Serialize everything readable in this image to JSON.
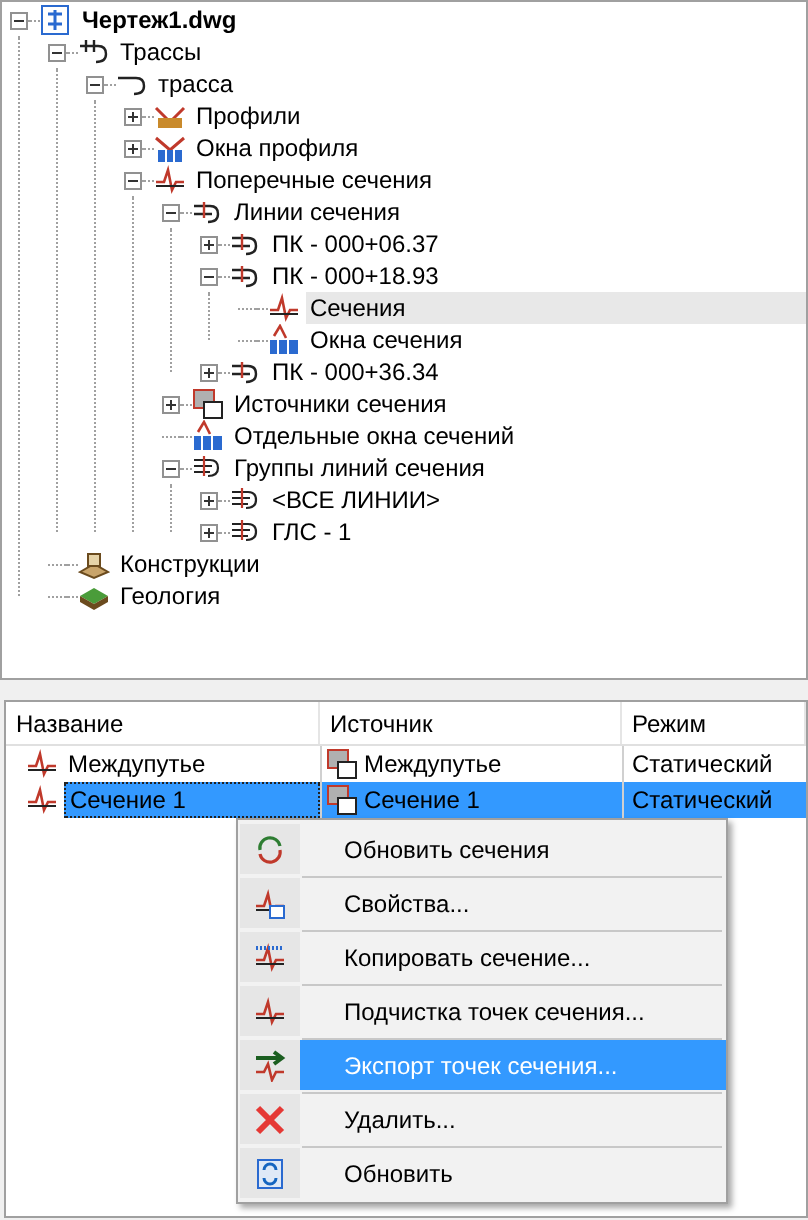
{
  "tree": [
    {
      "label": "Чертеж1.dwg",
      "kind": "drawing",
      "expanded": true,
      "selected": false,
      "children": [
        {
          "label": "Трассы",
          "kind": "alignments",
          "expanded": true,
          "selected": false,
          "children": [
            {
              "label": "трасса",
              "kind": "alignment",
              "expanded": true,
              "selected": false,
              "children": [
                {
                  "label": "Профили",
                  "kind": "profile",
                  "expanded": false,
                  "selected": false
                },
                {
                  "label": "Окна профиля",
                  "kind": "profile-view",
                  "expanded": false,
                  "selected": false
                },
                {
                  "label": "Поперечные сечения",
                  "kind": "section",
                  "expanded": true,
                  "selected": false,
                  "children": [
                    {
                      "label": "Линии сечения",
                      "kind": "sample-line",
                      "expanded": true,
                      "selected": false,
                      "children": [
                        {
                          "label": "ПК - 000+06.37",
                          "kind": "sample-line",
                          "expanded": false,
                          "selected": false
                        },
                        {
                          "label": "ПК - 000+18.93",
                          "kind": "sample-line",
                          "expanded": true,
                          "selected": false,
                          "children": [
                            {
                              "label": "Сечения",
                              "kind": "section",
                              "selected": true
                            },
                            {
                              "label": "Окна сечения",
                              "kind": "section-view",
                              "selected": false
                            }
                          ]
                        },
                        {
                          "label": "ПК - 000+36.34",
                          "kind": "sample-line",
                          "expanded": false,
                          "selected": false
                        }
                      ]
                    },
                    {
                      "label": "Источники сечения",
                      "kind": "sources",
                      "expanded": false,
                      "selected": false
                    },
                    {
                      "label": "Отдельные окна сечений",
                      "kind": "section-view",
                      "selected": false
                    },
                    {
                      "label": "Группы линий сечения",
                      "kind": "group",
                      "expanded": true,
                      "selected": false,
                      "children": [
                        {
                          "label": "<ВСЕ ЛИНИИ>",
                          "kind": "group",
                          "expanded": false,
                          "selected": false
                        },
                        {
                          "label": "ГЛС - 1",
                          "kind": "group",
                          "expanded": false,
                          "selected": false
                        }
                      ]
                    }
                  ]
                }
              ]
            }
          ]
        },
        {
          "label": "Конструкции",
          "kind": "structure",
          "selected": false
        },
        {
          "label": "Геология",
          "kind": "geology",
          "selected": false
        }
      ]
    }
  ],
  "table": {
    "columns": [
      "Название",
      "Источник",
      "Режим"
    ],
    "rows": [
      {
        "name": "Междупутье",
        "source": "Междупутье",
        "mode": "Статический",
        "selected": false
      },
      {
        "name": "Сечение 1",
        "source": "Сечение 1",
        "mode": "Статический",
        "selected": true
      }
    ]
  },
  "context_menu": [
    {
      "label": "Обновить сечения",
      "kind": "update",
      "selected": false
    },
    {
      "label": "Свойства...",
      "kind": "properties",
      "selected": false
    },
    {
      "label": "Копировать сечение...",
      "kind": "copy",
      "selected": false
    },
    {
      "label": "Подчистка точек сечения...",
      "kind": "section",
      "selected": false
    },
    {
      "label": "Экспорт точек сечения...",
      "kind": "export",
      "selected": true
    },
    {
      "label": "Удалить...",
      "kind": "delete",
      "selected": false
    },
    {
      "label": "Обновить",
      "kind": "refresh",
      "selected": false
    }
  ]
}
